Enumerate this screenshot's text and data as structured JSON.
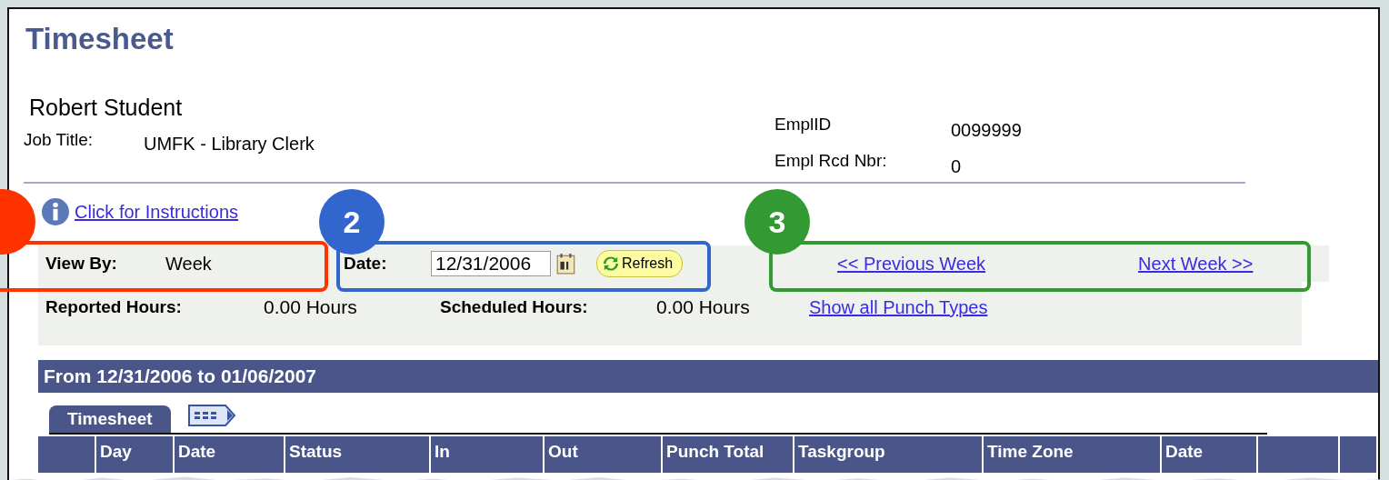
{
  "page": {
    "title": "Timesheet",
    "employee_name": "Robert Student",
    "job_title_label": "Job Title:",
    "job_title": "UMFK - Library Clerk",
    "emplid_label": "EmplID",
    "emplid": "0099999",
    "rcd_label": "Empl Rcd Nbr:",
    "rcd": "0"
  },
  "instructions_link": "Click for Instructions",
  "view_by": {
    "label": "View By:",
    "value": "Week"
  },
  "date": {
    "label": "Date:",
    "value": "12/31/2006",
    "refresh": "Refresh"
  },
  "navigation": {
    "previous": "<< Previous Week",
    "next": "Next Week >>"
  },
  "hours": {
    "reported_label": "Reported Hours:",
    "reported": "0.00 Hours",
    "scheduled_label": "Scheduled Hours:",
    "scheduled": "0.00 Hours",
    "punch_link": "Show all Punch Types"
  },
  "period": "From 12/31/2006 to 01/06/2007",
  "tabs": [
    {
      "label": "Timesheet",
      "selected": true
    }
  ],
  "table": {
    "columns": [
      "",
      "Day",
      "Date",
      "Status",
      "In",
      "Out",
      "Punch Total",
      "Taskgroup",
      "Time Zone",
      "Date",
      "",
      ""
    ]
  },
  "callouts": [
    {
      "color": "#ff3300"
    },
    {
      "number": "2",
      "color": "#3366cc"
    },
    {
      "number": "3",
      "color": "#339933"
    }
  ]
}
